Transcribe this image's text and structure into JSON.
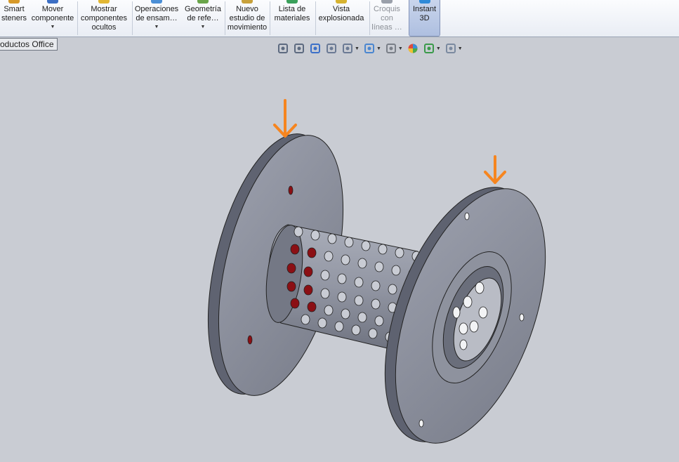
{
  "ribbon": {
    "buttons": [
      {
        "name": "smart-fasteners-button",
        "label": "Smart\nsteners",
        "dropdown": false,
        "icon": "fastener-icon",
        "disabled": false,
        "active": false
      },
      {
        "name": "move-component-button",
        "label": "Mover\ncomponente",
        "dropdown": true,
        "icon": "move-component-icon",
        "disabled": false,
        "active": false
      },
      {
        "name": "show-hidden-components-button",
        "label": "Mostrar\ncomponentes\nocultos",
        "dropdown": false,
        "icon": "show-hidden-icon",
        "disabled": false,
        "active": false
      },
      {
        "name": "assembly-features-button",
        "label": "Operaciones\nde ensam…",
        "dropdown": true,
        "icon": "assembly-features-icon",
        "disabled": false,
        "active": false
      },
      {
        "name": "reference-geometry-button",
        "label": "Geometría\nde refe…",
        "dropdown": true,
        "icon": "reference-geometry-icon",
        "disabled": false,
        "active": false
      },
      {
        "name": "new-motion-study-button",
        "label": "Nuevo\nestudio de\nmovimiento",
        "dropdown": false,
        "icon": "motion-study-icon",
        "disabled": false,
        "active": false
      },
      {
        "name": "bill-of-materials-button",
        "label": "Lista de\nmateriales",
        "dropdown": false,
        "icon": "bom-icon",
        "disabled": false,
        "active": false
      },
      {
        "name": "exploded-view-button",
        "label": "Vista\nexplosionada",
        "dropdown": false,
        "icon": "exploded-view-icon",
        "disabled": false,
        "active": false
      },
      {
        "name": "explode-line-sketch-button",
        "label": "Croquis\ncon\nlíneas …",
        "dropdown": false,
        "icon": "sketch-lines-icon",
        "disabled": true,
        "active": false
      },
      {
        "name": "instant-3d-button",
        "label": "Instant\n3D",
        "dropdown": false,
        "icon": "instant-3d-icon",
        "disabled": false,
        "active": true
      }
    ]
  },
  "tab": {
    "label": "oductos Office"
  },
  "heads_up_toolbar": [
    {
      "name": "zoom-to-fit-icon",
      "caret": false
    },
    {
      "name": "zoom-to-area-icon",
      "caret": false
    },
    {
      "name": "previous-view-icon",
      "caret": false
    },
    {
      "name": "section-view-icon",
      "caret": false
    },
    {
      "name": "view-orientation-icon",
      "caret": true
    },
    {
      "name": "display-style-icon",
      "caret": true
    },
    {
      "name": "hide-show-items-icon",
      "caret": true
    },
    {
      "name": "edit-appearance-icon",
      "caret": false
    },
    {
      "name": "apply-scene-icon",
      "caret": true
    },
    {
      "name": "view-settings-icon",
      "caret": true
    }
  ],
  "colors": {
    "viewport_bg": "#c9ccd3",
    "part_face": "#8a8e9a",
    "part_rim": "#5e6270",
    "hole_red": "#8b0f14",
    "annotation_arrow": "#f6851f"
  }
}
